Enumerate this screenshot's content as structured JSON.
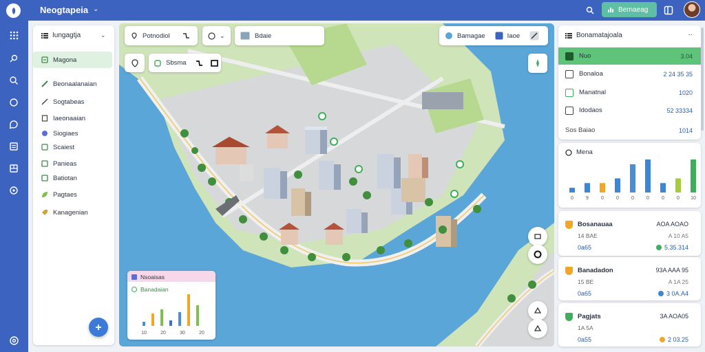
{
  "app": {
    "title": "Neogtapeia"
  },
  "topbar": {
    "action_label": "Bernaeag"
  },
  "sidebar": {
    "header": "Iungagtja",
    "items": [
      {
        "label": "Magona",
        "icon": "layers-icon",
        "active": true
      },
      {
        "label": "Beonaalanaian",
        "icon": "pencil-icon"
      },
      {
        "label": "Sogtabeas",
        "icon": "ruler-icon"
      },
      {
        "label": "Iaeonaaian",
        "icon": "doc-icon"
      },
      {
        "label": "Siogiaes",
        "icon": "globe-icon"
      },
      {
        "label": "Scaiest",
        "icon": "grid-icon"
      },
      {
        "label": "Panieas",
        "icon": "square-icon"
      },
      {
        "label": "Batiotan",
        "icon": "square-icon"
      },
      {
        "label": "Pagtaes",
        "icon": "leaf-icon"
      },
      {
        "label": "Kanagenian",
        "icon": "tag-icon"
      }
    ]
  },
  "map_toolbar": {
    "chip1_label": "Potnodiol",
    "chip2_label": "Bdaie",
    "chip3_label": "Sbsma",
    "layer_chip_label": "Bamagae",
    "layer_chip_label2": "Iaoe"
  },
  "mini_panel": {
    "title": "Nsoaisas",
    "subtitle": "Banadaian",
    "chart_values": [
      3,
      9,
      12,
      4,
      10,
      23,
      15
    ],
    "ticks": [
      "10",
      "20",
      "30",
      "20"
    ],
    "colors": [
      "#4a8ed6",
      "#f2a623",
      "#7fbf4d",
      "#3d6fc4"
    ]
  },
  "right_panel": {
    "header": "Bonamatajoala",
    "rows": [
      {
        "label": "Nuo",
        "value": "3.04",
        "active": true
      },
      {
        "label": "Bonaloa",
        "value": "2 24 35 35"
      },
      {
        "label": "Manatnal",
        "value": "1020"
      },
      {
        "label": "Idodaos",
        "value": "52 33334"
      },
      {
        "label": "Sos Baiao",
        "value": "1014"
      }
    ],
    "chart_title": "Mena",
    "chart": {
      "type": "bar",
      "categories": [
        "0",
        "9",
        "0",
        "0",
        "0",
        "0",
        "0",
        "0",
        "10"
      ],
      "values": [
        1,
        2,
        2,
        3,
        6,
        7,
        2,
        3,
        7
      ],
      "colors": [
        "#3d86d6",
        "#3d86d6",
        "#f2a623",
        "#3d86d6",
        "#4a8ed6",
        "#3d86d6",
        "#3d86d6",
        "#a7cc3c",
        "#3fae5a"
      ]
    },
    "stats": [
      {
        "title": "Bosanauaa",
        "value": "AOA AOAO",
        "sub": "14 BAE",
        "sub_val": "A 10 A5",
        "amount_label": "0a65",
        "amount": "5.35.314",
        "color": "#f2a623"
      },
      {
        "title": "Banadadon",
        "value": "93A AAA 95",
        "sub": "15 BE",
        "sub_val": "A 1A 25",
        "amount_label": "0a65",
        "amount": "3 0A.A4",
        "color": "#f2a623"
      },
      {
        "title": "Pagjats",
        "value": "3A AOA05",
        "sub": "1A 5A",
        "sub_val": "",
        "amount_label": "0a55",
        "amount": "2 03.25",
        "color": "#3fae5a"
      }
    ]
  }
}
